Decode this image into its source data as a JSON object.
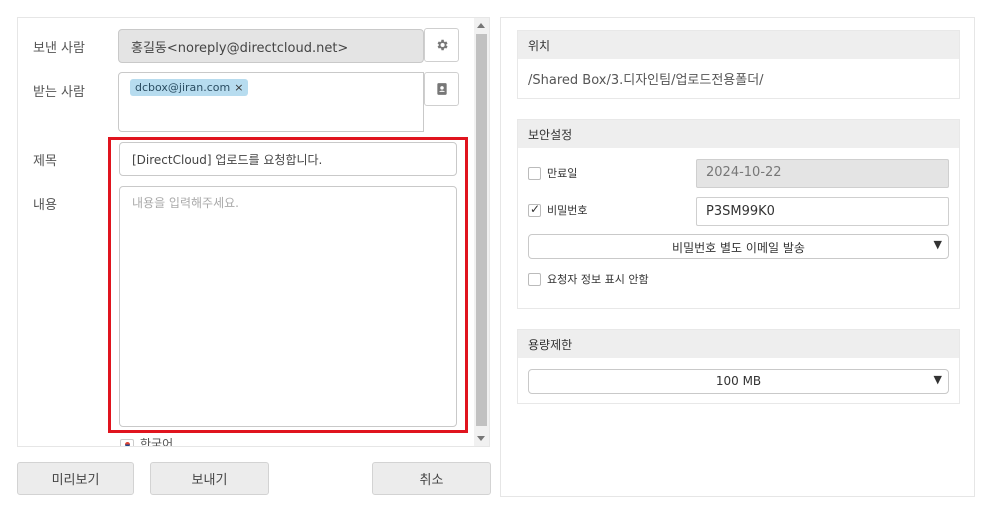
{
  "compose": {
    "sender_label": "보낸 사람",
    "sender_value": "홍길동<noreply@directcloud.net>",
    "recipient_label": "받는 사람",
    "recipients": [
      "dcbox@jiran.com"
    ],
    "chip_remove": "×",
    "subject_label": "제목",
    "subject_value": "[DirectCloud] 업로드를 요청합니다.",
    "body_label": "내용",
    "body_placeholder": "내용을 입력해주세요.",
    "language": "한국어"
  },
  "icons": {
    "settings": "gear-icon",
    "address_book": "contact-book-icon"
  },
  "footer": {
    "preview_label": "미리보기",
    "send_label": "보내기",
    "cancel_label": "취소"
  },
  "location": {
    "header": "위치",
    "path": "/Shared Box/3.디자인팀/업로드전용폴더/"
  },
  "security": {
    "header": "보안설정",
    "expiry_label": "만료일",
    "expiry_checked": false,
    "expiry_date": "2024-10-22",
    "password_label": "비밀번호",
    "password_checked": true,
    "password_value": "P3SM99K0",
    "password_send_option": "비밀번호 별도 이메일 발송",
    "hide_requester_label": "요청자 정보 표시 안함",
    "hide_requester_checked": false
  },
  "capacity": {
    "header": "용량제한",
    "limit_value": "100 MB"
  },
  "colors": {
    "highlight": "#e0141e",
    "chip_bg": "#b7dcef"
  }
}
